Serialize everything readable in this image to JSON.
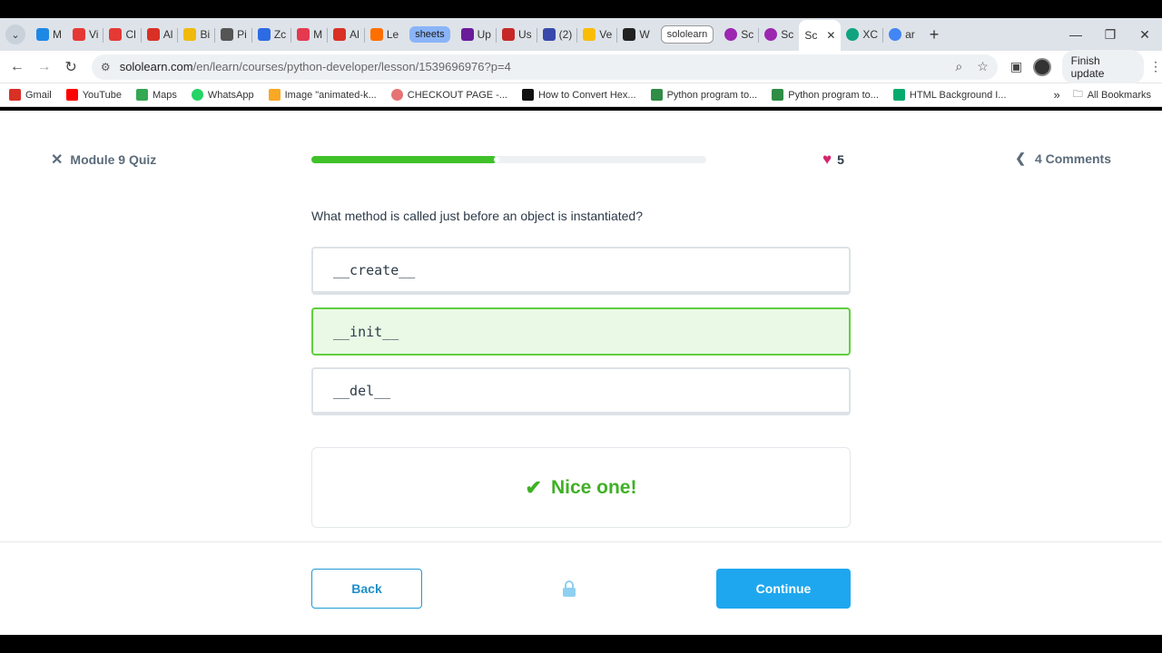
{
  "browser": {
    "tabs": [
      {
        "label": "M",
        "color": "#1e88e5"
      },
      {
        "label": "Vi",
        "color": "#e53935"
      },
      {
        "label": "Cl",
        "color": "#e53935"
      },
      {
        "label": "Al",
        "color": "#d93025"
      },
      {
        "label": "Bi",
        "color": "#f0b90b"
      },
      {
        "label": "Pi",
        "color": "#555555"
      },
      {
        "label": "Zc",
        "color": "#2d6be4"
      },
      {
        "label": "M",
        "color": "#e53950"
      },
      {
        "label": "Al",
        "color": "#d93025"
      },
      {
        "label": "Le",
        "color": "#ff6f00"
      }
    ],
    "group_sheets": "sheets",
    "tabs2": [
      {
        "label": "Up",
        "color": "#6a1b9a"
      },
      {
        "label": "Us",
        "color": "#c62828"
      },
      {
        "label": "(2)",
        "color": "#3949ab"
      },
      {
        "label": "Ve",
        "color": "#fbbc04"
      },
      {
        "label": "W",
        "color": "#222222"
      }
    ],
    "group_sololearn": "sololearn",
    "tabs3": [
      {
        "label": "Sc",
        "color": "#9c27b0"
      },
      {
        "label": "Sc",
        "color": "#9c27b0"
      }
    ],
    "active_tab": "Sc",
    "tabs4": [
      {
        "label": "XC",
        "color": "#10a37f"
      },
      {
        "label": "ar",
        "color": "#4285f4"
      }
    ],
    "url_host": "sololearn.com",
    "url_path": "/en/learn/courses/python-developer/lesson/1539696976?p=4",
    "finish_update": "Finish update",
    "bookmarks": [
      {
        "label": "Gmail",
        "color": "#d93025"
      },
      {
        "label": "YouTube",
        "color": "#ff0000"
      },
      {
        "label": "Maps",
        "color": "#34a853"
      },
      {
        "label": "WhatsApp",
        "color": "#25d366"
      },
      {
        "label": "Image \"animated-k...",
        "color": "#f9a825"
      },
      {
        "label": "CHECKOUT PAGE -...",
        "color": "#e57373"
      },
      {
        "label": "How to Convert Hex...",
        "color": "#111111"
      },
      {
        "label": "Python program to...",
        "color": "#2f8d46"
      },
      {
        "label": "Python program to...",
        "color": "#2f8d46"
      },
      {
        "label": "HTML Background I...",
        "color": "#04aa6d"
      }
    ],
    "all_bookmarks": "All Bookmarks"
  },
  "quiz": {
    "module_title": "Module 9 Quiz",
    "progress_percent": 47,
    "hearts": "5",
    "comments": "4 Comments",
    "question": "What method is called just before an object is instantiated?",
    "options": [
      "__create__",
      "__init__",
      "__del__"
    ],
    "correct_index": 1,
    "feedback": "Nice one!",
    "back_label": "Back",
    "continue_label": "Continue",
    "accent_color": "#1ea7ef",
    "success_color": "#3fb125"
  }
}
